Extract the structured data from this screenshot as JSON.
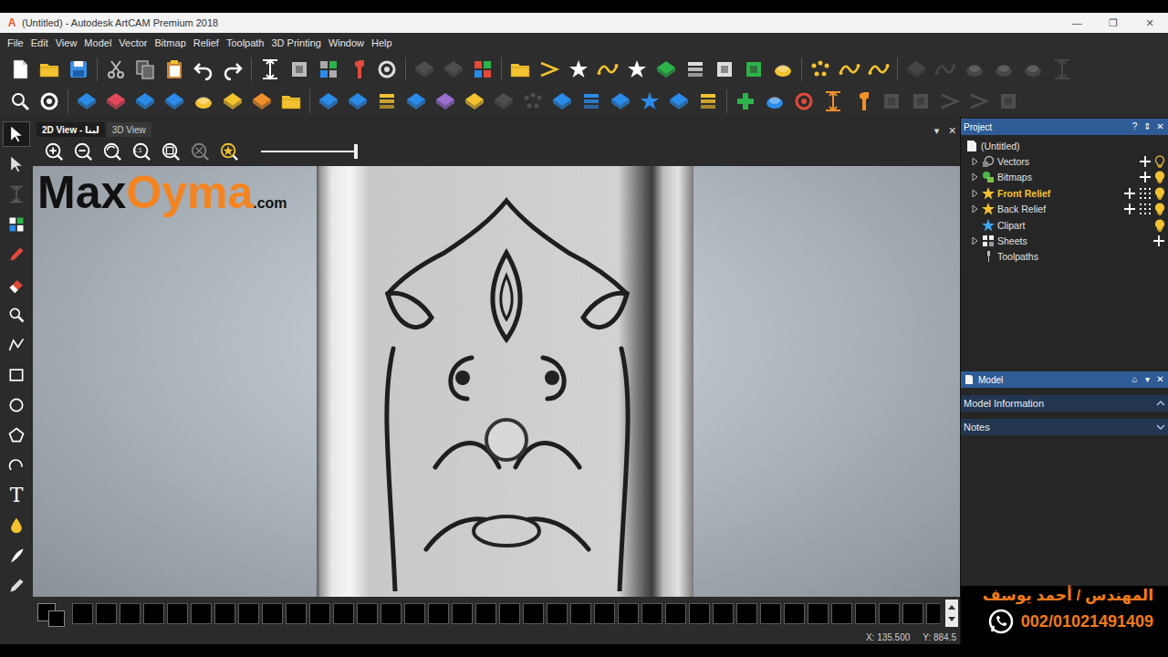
{
  "window": {
    "app_icon": "A",
    "title": "(Untitled) - Autodesk ArtCAM Premium 2018",
    "controls": [
      "—",
      "❐",
      "✕"
    ]
  },
  "menu": [
    "File",
    "Edit",
    "View",
    "Model",
    "Vector",
    "Bitmap",
    "Relief",
    "Toolpath",
    "3D Printing",
    "Window",
    "Help"
  ],
  "toolbar_rows": [
    [
      {
        "kind": "sheet",
        "color": "#ffffff",
        "disabled": false
      },
      {
        "kind": "folder",
        "color": "#f2c230",
        "disabled": false
      },
      {
        "kind": "disk",
        "color": "#3a8ee6",
        "disabled": false
      },
      {
        "kind": "separator",
        "color": "#555555",
        "disabled": false
      },
      {
        "kind": "scissors",
        "color": "#bbbbbb",
        "disabled": false
      },
      {
        "kind": "copy",
        "color": "#aaaaaa",
        "disabled": false
      },
      {
        "kind": "clipboard",
        "color": "#f2c230",
        "disabled": false
      },
      {
        "kind": "undo",
        "color": "#ffffff",
        "disabled": false
      },
      {
        "kind": "redo",
        "color": "#ffffff",
        "disabled": false
      },
      {
        "kind": "separator",
        "color": "#555555",
        "disabled": false
      },
      {
        "kind": "resize",
        "color": "#ffffff",
        "disabled": false
      },
      {
        "kind": "square",
        "color": "#bbbbbb",
        "disabled": false
      },
      {
        "kind": "grid",
        "color": "#aaaaaa",
        "disabled": false
      },
      {
        "kind": "tool",
        "color": "#e24a3b",
        "disabled": false
      },
      {
        "kind": "ring",
        "color": "#dddddd",
        "disabled": false
      },
      {
        "kind": "separator",
        "color": "#555555",
        "disabled": false
      },
      {
        "kind": "diamond",
        "color": "#777777",
        "disabled": true
      },
      {
        "kind": "diamond",
        "color": "#777777",
        "disabled": true
      },
      {
        "kind": "grid",
        "color": "#e24a3b",
        "disabled": false
      },
      {
        "kind": "separator",
        "color": "#555555",
        "disabled": false
      },
      {
        "kind": "folder",
        "color": "#f2c230",
        "disabled": false
      },
      {
        "kind": "chevron",
        "color": "#f2c230",
        "disabled": false
      },
      {
        "kind": "star",
        "color": "#ffffff",
        "disabled": false
      },
      {
        "kind": "wave",
        "color": "#f2c230",
        "disabled": false
      },
      {
        "kind": "star",
        "color": "#ffffff",
        "disabled": false
      },
      {
        "kind": "diamond",
        "color": "#2db34a",
        "disabled": false
      },
      {
        "kind": "stack",
        "color": "#dddddd",
        "disabled": false
      },
      {
        "kind": "square",
        "color": "#dddddd",
        "disabled": false
      },
      {
        "kind": "square",
        "color": "#2db34a",
        "disabled": false
      },
      {
        "kind": "blob",
        "color": "#f2c230",
        "disabled": false
      },
      {
        "kind": "separator",
        "color": "#555555",
        "disabled": false
      },
      {
        "kind": "dots",
        "color": "#f2c230",
        "disabled": false
      },
      {
        "kind": "wave",
        "color": "#f2c230",
        "disabled": false
      },
      {
        "kind": "wave",
        "color": "#f2c230",
        "disabled": false
      },
      {
        "kind": "separator",
        "color": "#555555",
        "disabled": false
      },
      {
        "kind": "diamond",
        "color": "#666666",
        "disabled": true
      },
      {
        "kind": "wave",
        "color": "#666666",
        "disabled": true
      },
      {
        "kind": "blob",
        "color": "#666666",
        "disabled": true
      },
      {
        "kind": "blob",
        "color": "#666666",
        "disabled": true
      },
      {
        "kind": "blob",
        "color": "#666666",
        "disabled": true
      },
      {
        "kind": "resize",
        "color": "#666666",
        "disabled": true
      }
    ],
    [
      {
        "kind": "magnifier",
        "color": "#ffffff",
        "disabled": false
      },
      {
        "kind": "ring",
        "color": "#ffffff",
        "disabled": false
      },
      {
        "kind": "separator",
        "color": "#555555",
        "disabled": false
      },
      {
        "kind": "diamond",
        "color": "#2b8be8",
        "disabled": false
      },
      {
        "kind": "diamond",
        "color": "#e24a5b",
        "disabled": false
      },
      {
        "kind": "diamond",
        "color": "#2b8be8",
        "disabled": false
      },
      {
        "kind": "diamond",
        "color": "#2b8be8",
        "disabled": false
      },
      {
        "kind": "blob",
        "color": "#f2c230",
        "disabled": false
      },
      {
        "kind": "diamond",
        "color": "#f2c230",
        "disabled": false
      },
      {
        "kind": "diamond",
        "color": "#f0902a",
        "disabled": false
      },
      {
        "kind": "folder",
        "color": "#f2c230",
        "disabled": false
      },
      {
        "kind": "separator",
        "color": "#555555",
        "disabled": false
      },
      {
        "kind": "diamond",
        "color": "#2b8be8",
        "disabled": false
      },
      {
        "kind": "diamond",
        "color": "#2b8be8",
        "disabled": false
      },
      {
        "kind": "stack",
        "color": "#f2c230",
        "disabled": false
      },
      {
        "kind": "diamond",
        "color": "#2b8be8",
        "disabled": false
      },
      {
        "kind": "diamond",
        "color": "#9a6fd0",
        "disabled": false
      },
      {
        "kind": "diamond",
        "color": "#f2c230",
        "disabled": false
      },
      {
        "kind": "diamond",
        "color": "#777777",
        "disabled": true
      },
      {
        "kind": "dots",
        "color": "#777777",
        "disabled": true
      },
      {
        "kind": "diamond",
        "color": "#2b8be8",
        "disabled": false
      },
      {
        "kind": "stack",
        "color": "#2b8be8",
        "disabled": false
      },
      {
        "kind": "diamond",
        "color": "#2b8be8",
        "disabled": false
      },
      {
        "kind": "star",
        "color": "#2b8be8",
        "disabled": false
      },
      {
        "kind": "diamond",
        "color": "#2b8be8",
        "disabled": false
      },
      {
        "kind": "stack",
        "color": "#f2c230",
        "disabled": false
      },
      {
        "kind": "separator",
        "color": "#555555",
        "disabled": false
      },
      {
        "kind": "plus",
        "color": "#2db34a",
        "disabled": false
      },
      {
        "kind": "blob",
        "color": "#2b8be8",
        "disabled": false
      },
      {
        "kind": "ring",
        "color": "#e24a3b",
        "disabled": false
      },
      {
        "kind": "resize",
        "color": "#f0902a",
        "disabled": false
      },
      {
        "kind": "tool",
        "color": "#f0902a",
        "disabled": false
      },
      {
        "kind": "square",
        "color": "#777777",
        "disabled": true
      },
      {
        "kind": "square",
        "color": "#777777",
        "disabled": true
      },
      {
        "kind": "chevron",
        "color": "#777777",
        "disabled": true
      },
      {
        "kind": "chevron",
        "color": "#777777",
        "disabled": true
      },
      {
        "kind": "square",
        "color": "#777777",
        "disabled": true
      }
    ]
  ],
  "tools": [
    {
      "kind": "pointer",
      "color": "#ffffff",
      "selected": true,
      "disabled": false,
      "glyph": ""
    },
    {
      "kind": "pointer",
      "color": "#dddddd",
      "selected": false,
      "disabled": false,
      "glyph": ""
    },
    {
      "kind": "resize",
      "color": "#888888",
      "selected": false,
      "disabled": true,
      "glyph": ""
    },
    {
      "kind": "grid",
      "color": "#ffffff",
      "selected": false,
      "disabled": false,
      "glyph": ""
    },
    {
      "kind": "pencil",
      "color": "#e24a3b",
      "selected": false,
      "disabled": false,
      "glyph": ""
    },
    {
      "kind": "eraser",
      "color": "#e24a3b",
      "selected": false,
      "disabled": false,
      "glyph": ""
    },
    {
      "kind": "magnifier",
      "color": "#ffffff",
      "selected": false,
      "disabled": false,
      "glyph": ""
    },
    {
      "kind": "polyline",
      "color": "#ffffff",
      "selected": false,
      "disabled": false,
      "glyph": ""
    },
    {
      "kind": "rect",
      "color": "#ffffff",
      "selected": false,
      "disabled": false,
      "glyph": ""
    },
    {
      "kind": "circle",
      "color": "#ffffff",
      "selected": false,
      "disabled": false,
      "glyph": ""
    },
    {
      "kind": "polygon",
      "color": "#ffffff",
      "selected": false,
      "disabled": false,
      "glyph": ""
    },
    {
      "kind": "arc",
      "color": "#ffffff",
      "selected": false,
      "disabled": false,
      "glyph": ""
    },
    {
      "kind": "text",
      "color": "#ffffff",
      "selected": false,
      "disabled": false,
      "glyph": "T"
    },
    {
      "kind": "drop",
      "color": "#f2c230",
      "selected": false,
      "disabled": false,
      "glyph": ""
    },
    {
      "kind": "feather",
      "color": "#ffffff",
      "selected": false,
      "disabled": false,
      "glyph": ""
    },
    {
      "kind": "pencil",
      "color": "#dddddd",
      "selected": false,
      "disabled": false,
      "glyph": ""
    }
  ],
  "view_tabs": [
    {
      "label": "2D View - لبنا",
      "selected": true
    },
    {
      "label": "3D View",
      "selected": false
    }
  ],
  "view_controls": [
    "▾",
    "✕"
  ],
  "view_toolbar": {
    "buttons": [
      {
        "kind": "zoom-in",
        "label": "",
        "disabled": false
      },
      {
        "kind": "zoom-out",
        "label": "",
        "disabled": false
      },
      {
        "kind": "zoom-fit",
        "label": "",
        "disabled": false
      },
      {
        "kind": "zoom-actual",
        "label": "1:1",
        "disabled": false
      },
      {
        "kind": "zoom-box",
        "label": "",
        "disabled": false
      },
      {
        "kind": "zoom-clear",
        "label": "",
        "disabled": true
      },
      {
        "kind": "zoom-star",
        "label": "",
        "disabled": false
      }
    ],
    "slider": {
      "level": 1.0
    }
  },
  "watermark": {
    "part1": "Max",
    "part2": "Oyma",
    "suffix": ".com"
  },
  "palette": {
    "primary": "#000000",
    "secondary": "#000000",
    "swatches": [
      "#000000",
      "#000000",
      "#000000",
      "#000000",
      "#000000",
      "#000000",
      "#000000",
      "#000000",
      "#000000",
      "#000000",
      "#000000",
      "#000000",
      "#000000",
      "#000000",
      "#000000",
      "#000000",
      "#000000",
      "#000000",
      "#000000",
      "#000000",
      "#000000",
      "#000000",
      "#000000",
      "#000000",
      "#000000",
      "#000000",
      "#000000",
      "#000000",
      "#000000",
      "#000000",
      "#000000",
      "#000000",
      "#000000",
      "#000000",
      "#000000",
      "#000000",
      "#000000",
      "#000000"
    ]
  },
  "status": {
    "x": "X: 135.500",
    "y": "Y: 884.5"
  },
  "project": {
    "title": "Project",
    "header_buttons": [
      "?",
      "⇕",
      "✕"
    ],
    "items": [
      {
        "label": "(Untitled)",
        "icon": "doc",
        "level": 0,
        "expandable": false,
        "expanded": false,
        "selected": false,
        "add": false,
        "grid": false,
        "bulb": "none"
      },
      {
        "label": "Vectors",
        "icon": "vectors",
        "level": 1,
        "expandable": true,
        "expanded": false,
        "selected": false,
        "add": true,
        "grid": false,
        "bulb": "off"
      },
      {
        "label": "Bitmaps",
        "icon": "bitmaps",
        "level": 1,
        "expandable": true,
        "expanded": false,
        "selected": false,
        "add": true,
        "grid": false,
        "bulb": "on"
      },
      {
        "label": "Front Relief",
        "icon": "relief",
        "level": 1,
        "expandable": true,
        "expanded": false,
        "selected": true,
        "add": true,
        "grid": true,
        "bulb": "on"
      },
      {
        "label": "Back Relief",
        "icon": "relief",
        "level": 1,
        "expandable": true,
        "expanded": false,
        "selected": false,
        "add": true,
        "grid": true,
        "bulb": "on"
      },
      {
        "label": "Clipart",
        "icon": "clipart",
        "level": 1,
        "expandable": false,
        "expanded": false,
        "selected": false,
        "add": false,
        "grid": false,
        "bulb": "on"
      },
      {
        "label": "Sheets",
        "icon": "sheets",
        "level": 1,
        "expandable": true,
        "expanded": false,
        "selected": false,
        "add": true,
        "grid": false,
        "bulb": "none"
      },
      {
        "label": "Toolpaths",
        "icon": "toolpaths",
        "level": 1,
        "expandable": false,
        "expanded": false,
        "selected": false,
        "add": false,
        "grid": false,
        "bulb": "none"
      }
    ]
  },
  "model": {
    "title": "Model",
    "header_buttons": [
      "⌂",
      "▾",
      "✕"
    ],
    "sections": [
      {
        "label": "Model Information",
        "expanded": true
      },
      {
        "label": "Notes",
        "expanded": false
      }
    ]
  },
  "credit": {
    "name": "المهندس / أحمد يوسف",
    "phone": "002/01021491409"
  }
}
